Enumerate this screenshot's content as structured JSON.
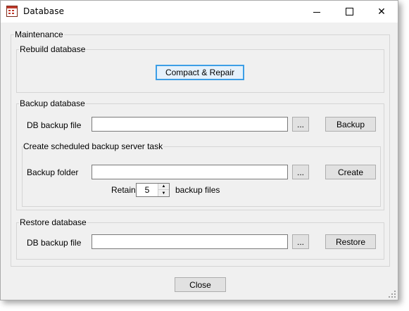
{
  "window": {
    "title": "Database",
    "minimize_icon": "minimize-icon",
    "maximize_icon": "maximize-icon",
    "close_icon": "close-icon"
  },
  "maintenance": {
    "label": "Maintenance",
    "rebuild": {
      "label": "Rebuild database",
      "compact_button": "Compact & Repair"
    },
    "backup": {
      "label": "Backup database",
      "file_label": "DB backup file",
      "file_value": "",
      "browse_button": "...",
      "backup_button": "Backup",
      "scheduled": {
        "label": "Create scheduled backup server task",
        "folder_label": "Backup folder",
        "folder_value": "",
        "browse_button": "...",
        "create_button": "Create",
        "retain_label": "Retain",
        "retain_value": "5",
        "retain_suffix": "backup files"
      }
    },
    "restore": {
      "label": "Restore database",
      "file_label": "DB backup file",
      "file_value": "",
      "browse_button": "...",
      "restore_button": "Restore"
    }
  },
  "footer": {
    "close_button": "Close"
  }
}
